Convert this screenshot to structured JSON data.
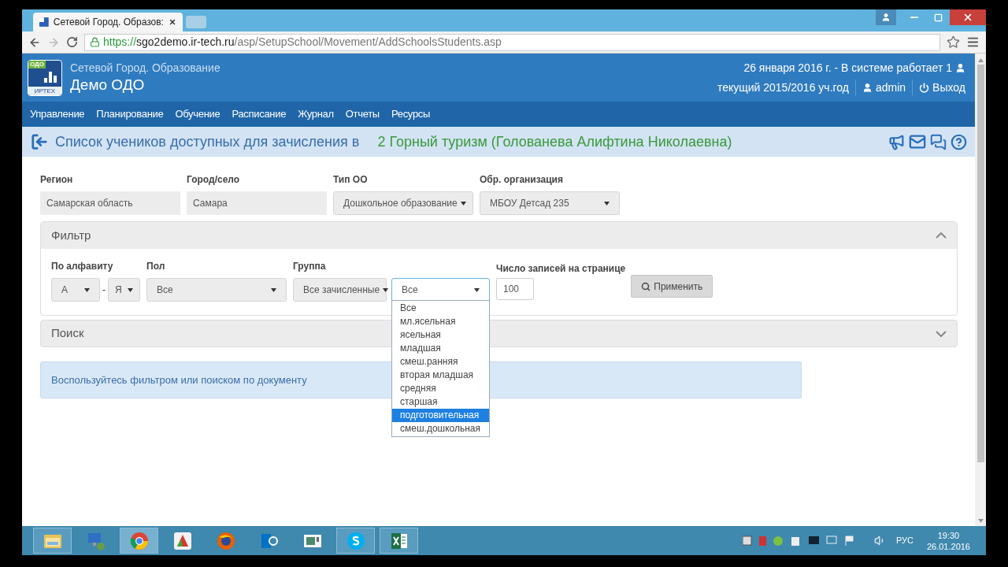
{
  "browser": {
    "tab_title": "Сетевой Город. Образов:",
    "url_scheme": "https://",
    "url_host": "sgo2demo.ir-tech.ru",
    "url_path": "/asp/SetupSchool/Movement/AddSchoolsStudents.asp"
  },
  "header": {
    "logo_top": "ОДО",
    "logo_bottom": "ИРТЕХ",
    "subtitle": "Сетевой Город. Образование",
    "title": "Демо ОДО",
    "status": "26 января 2016 г. - В системе работает 1",
    "year": "текущий 2015/2016 уч.год",
    "user": "admin",
    "logout": "Выход"
  },
  "nav": [
    "Управление",
    "Планирование",
    "Обучение",
    "Расписание",
    "Журнал",
    "Отчеты",
    "Ресурсы"
  ],
  "page_title": {
    "text": "Список учеников доступных для зачисления в",
    "group": "2 Горный туризм (Голованева Алифтина Николаевна)"
  },
  "fields": [
    {
      "label": "Регион",
      "value": "Самарская область",
      "kind": "readonly"
    },
    {
      "label": "Город/село",
      "value": "Самара",
      "kind": "readonly"
    },
    {
      "label": "Тип ОО",
      "value": "Дошкольное образование",
      "kind": "select"
    },
    {
      "label": "Обр. организация",
      "value": "МБОУ Детсад 235",
      "kind": "select"
    }
  ],
  "filter": {
    "title": "Фильтр",
    "expanded": true,
    "alpha": {
      "label": "По алфавиту",
      "from": "А",
      "separator": "-",
      "to": "Я"
    },
    "gender": {
      "label": "Пол",
      "value": "Все"
    },
    "group": {
      "label": "Группа",
      "value": "Все зачисленные",
      "sub_value": "Все",
      "open": true,
      "options": [
        {
          "label": "Все",
          "selected": false
        },
        {
          "label": "мл.ясельная",
          "selected": false
        },
        {
          "label": "ясельная",
          "selected": false
        },
        {
          "label": "младшая",
          "selected": false
        },
        {
          "label": "смеш.ранняя",
          "selected": false
        },
        {
          "label": "вторая младшая",
          "selected": false
        },
        {
          "label": "средняя",
          "selected": false
        },
        {
          "label": "старшая",
          "selected": false
        },
        {
          "label": "подготовительная",
          "selected": true
        },
        {
          "label": "смеш.дошкольная",
          "selected": false
        }
      ]
    },
    "per_page": {
      "label": "Число записей на странице",
      "value": "100"
    },
    "apply": "Применить"
  },
  "search": {
    "title": "Поиск",
    "expanded": false
  },
  "notice": "Воспользуйтесь фильтром или поиском по документу",
  "taskbar": {
    "apps": [
      {
        "kind": "folder",
        "running": true,
        "selected": false
      },
      {
        "kind": "remote",
        "running": false,
        "selected": false
      },
      {
        "kind": "chrome",
        "running": true,
        "selected": true
      },
      {
        "kind": "capture",
        "running": false,
        "selected": false
      },
      {
        "kind": "firefox",
        "running": false,
        "selected": false
      },
      {
        "kind": "lync",
        "running": false,
        "selected": false
      },
      {
        "kind": "window",
        "running": false,
        "selected": false
      },
      {
        "kind": "skype",
        "running": true,
        "selected": false
      },
      {
        "kind": "excel",
        "running": true,
        "selected": false
      }
    ],
    "lang": "РУС",
    "time": "19:30",
    "date": "26.01.2016"
  }
}
